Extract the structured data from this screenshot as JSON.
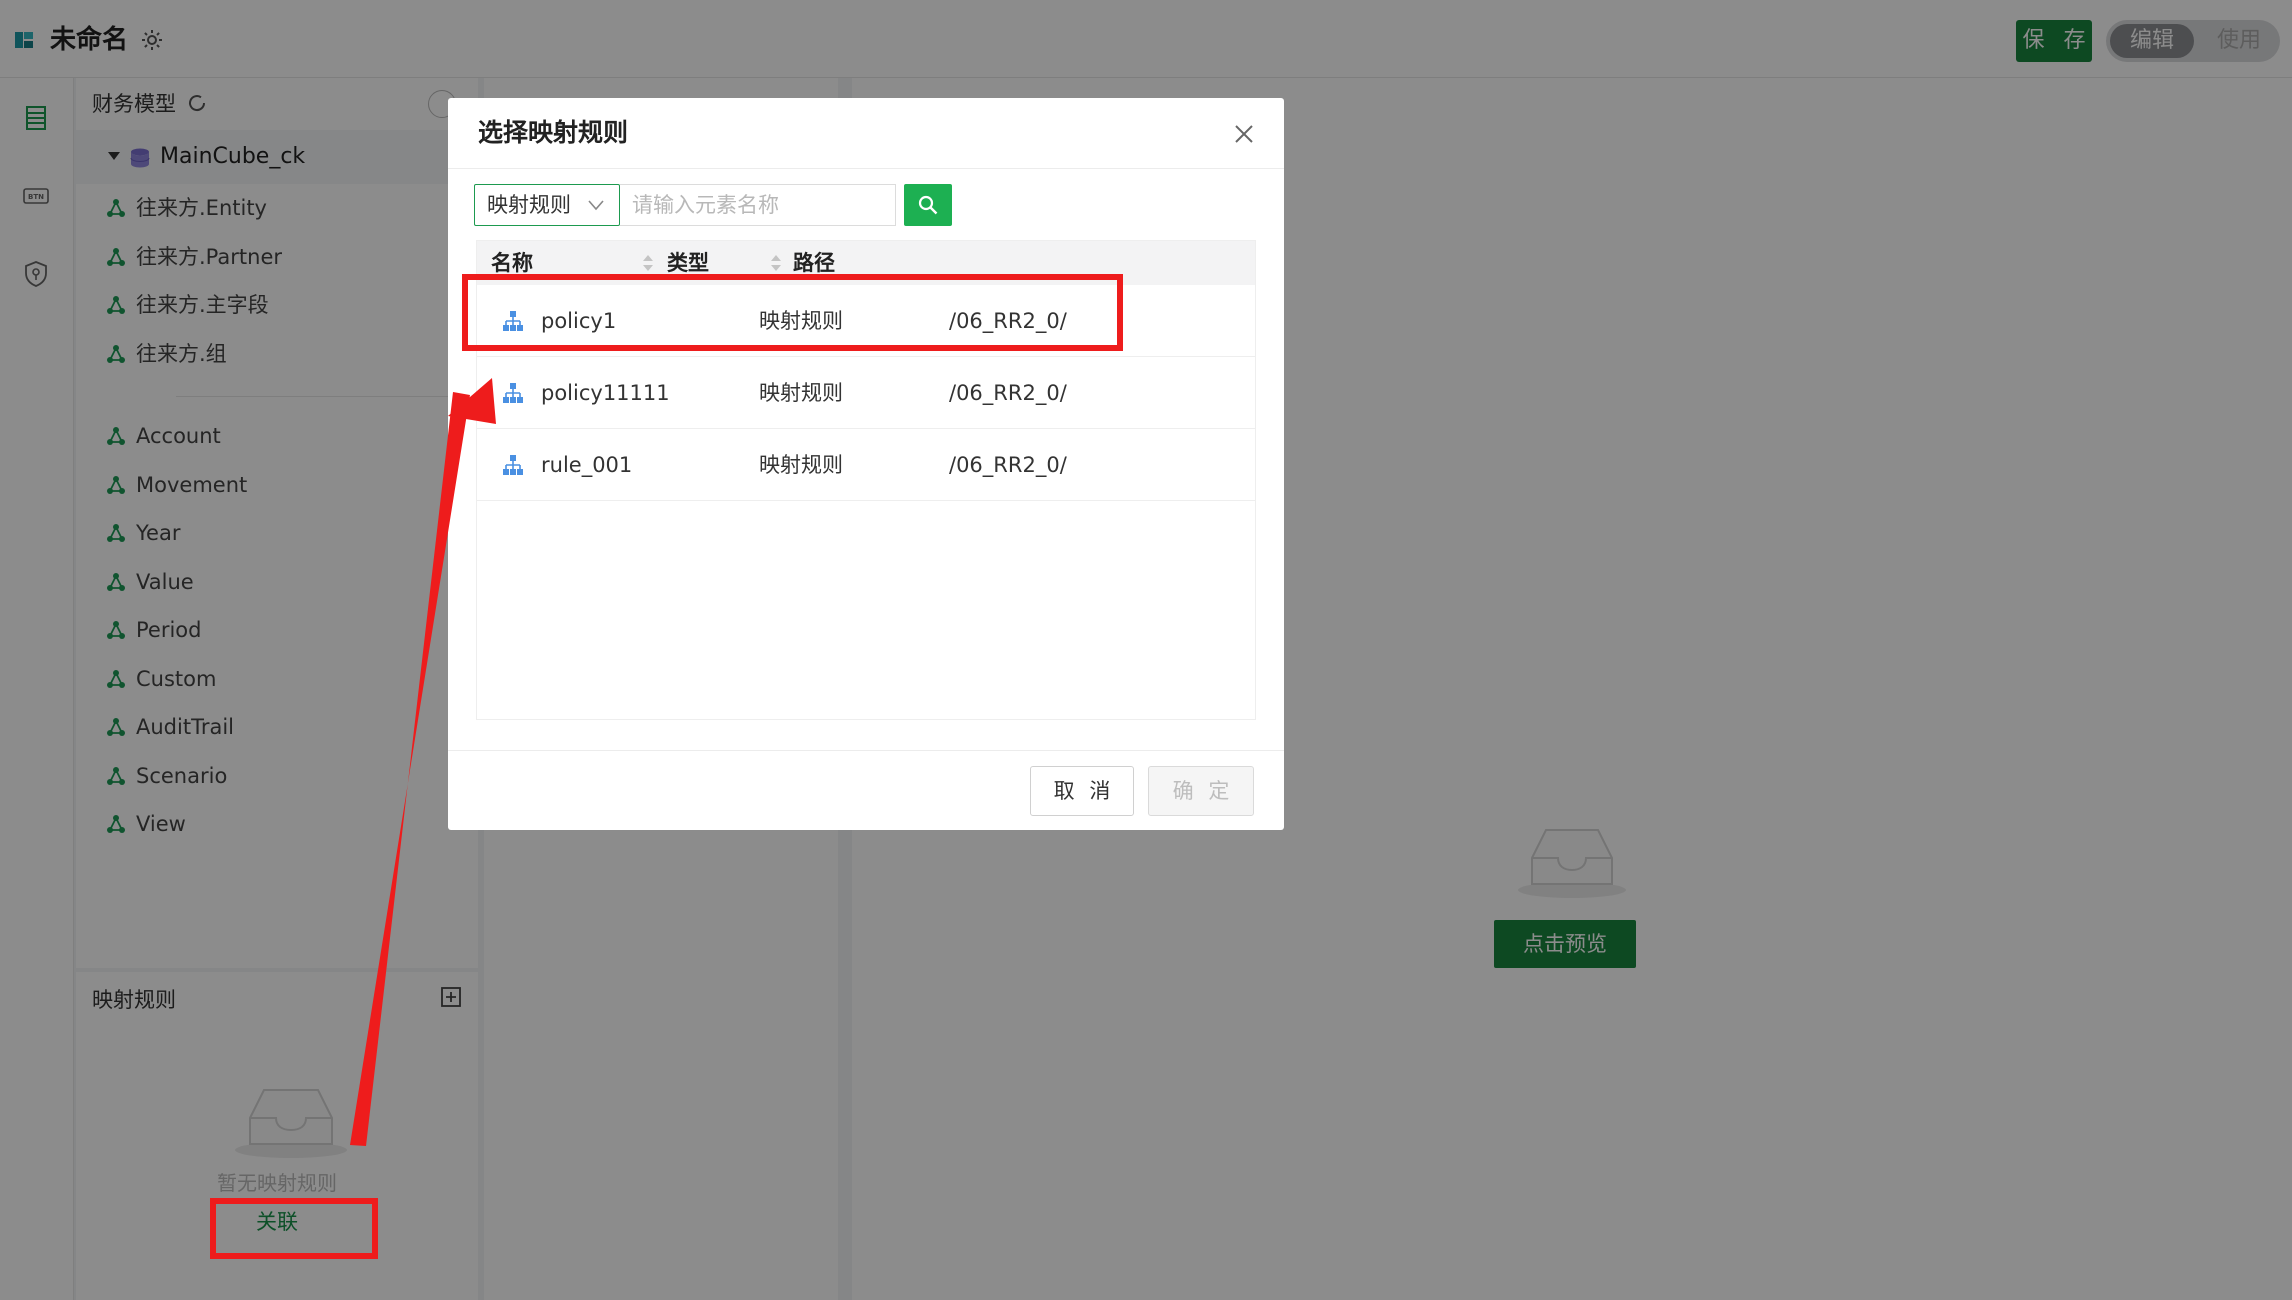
{
  "app": {
    "title": "未命名",
    "save_label": "保 存",
    "mode_edit_label": "编辑",
    "mode_use_label": "使用",
    "accent_color": "#18853f"
  },
  "rail": {
    "icons": [
      "table-icon",
      "btn-component-icon",
      "shield-icon"
    ]
  },
  "model_panel": {
    "title": "财务模型",
    "cube_label": "MainCube_ck",
    "dimensions_group1": [
      "往来方.Entity",
      "往来方.Partner",
      "往来方.主字段",
      "往来方.组"
    ],
    "dimensions_group2": [
      "Account",
      "Movement",
      "Year",
      "Value",
      "Period",
      "Custom",
      "AuditTrail",
      "Scenario",
      "View"
    ]
  },
  "rule_panel": {
    "title": "映射规则",
    "empty_text": "暂无映射规则",
    "link_label": "关联"
  },
  "right_panel": {
    "preview_label": "点击预览"
  },
  "modal": {
    "title": "选择映射规则",
    "filter_value": "映射规则",
    "search_placeholder": "请输入元素名称",
    "columns": {
      "name": "名称",
      "type": "类型",
      "path": "路径"
    },
    "rows": [
      {
        "name": "policy1",
        "type": "映射规则",
        "path": "/06_RR2_0/"
      },
      {
        "name": "policy11111",
        "type": "映射规则",
        "path": "/06_RR2_0/"
      },
      {
        "name": "rule_001",
        "type": "映射规则",
        "path": "/06_RR2_0/"
      }
    ],
    "cancel_label": "取 消",
    "ok_label": "确 定"
  },
  "annotation_color": "#ee1c1c"
}
